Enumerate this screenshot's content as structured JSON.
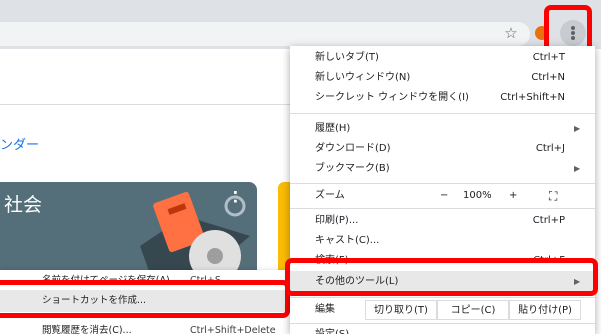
{
  "browser": {
    "star_glyph": "☆",
    "extension_color": "#e8710a"
  },
  "page": {
    "link_text": "ンダー",
    "card_title": "社会",
    "card_menu_glyph": "⋮"
  },
  "menu": {
    "new_tab": {
      "label": "新しいタブ(T)",
      "shortcut": "Ctrl+T"
    },
    "new_window": {
      "label": "新しいウィンドウ(N)",
      "shortcut": "Ctrl+N"
    },
    "incognito": {
      "label": "シークレット ウィンドウを開く(I)",
      "shortcut": "Ctrl+Shift+N"
    },
    "history": {
      "label": "履歴(H)"
    },
    "downloads": {
      "label": "ダウンロード(D)",
      "shortcut": "Ctrl+J"
    },
    "bookmarks": {
      "label": "ブックマーク(B)"
    },
    "zoom": {
      "label": "ズーム",
      "minus": "−",
      "value": "100%",
      "plus": "+",
      "fullscreen_glyph": "⛶"
    },
    "print": {
      "label": "印刷(P)...",
      "shortcut": "Ctrl+P"
    },
    "cast": {
      "label": "キャスト(C)..."
    },
    "find": {
      "label": "検索(F)...",
      "shortcut": "Ctrl+F"
    },
    "more_tools": {
      "label": "その他のツール(L)"
    },
    "edit": {
      "label": "編集",
      "cut": "切り取り(T)",
      "copy": "コピー(C)",
      "paste": "貼り付け(P)"
    },
    "settings": {
      "label": "設定(S)"
    },
    "arrow_glyph": "▶"
  },
  "submenu": {
    "save_page": {
      "label": "名前を付けてページを保存(A)...",
      "shortcut": "Ctrl+S"
    },
    "create_shortcut": {
      "label": "ショートカットを作成..."
    },
    "clear_data": {
      "label": "閲覧履歴を消去(C)...",
      "shortcut": "Ctrl+Shift+Delete"
    }
  },
  "highlight_color": "#ff0000"
}
